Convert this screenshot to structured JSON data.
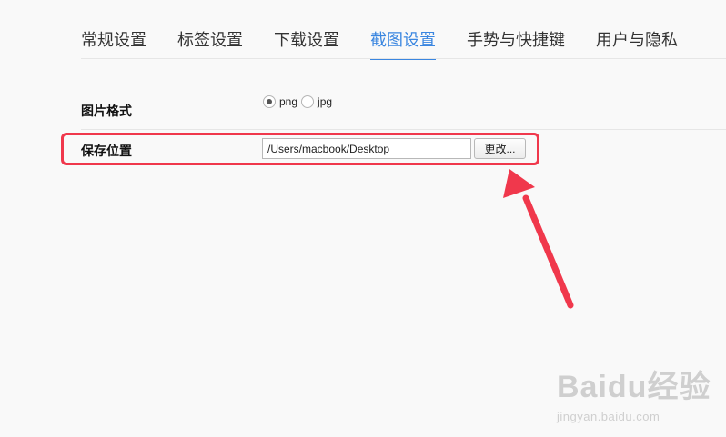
{
  "tabs": [
    {
      "label": "常规设置",
      "active": false
    },
    {
      "label": "标签设置",
      "active": false
    },
    {
      "label": "下载设置",
      "active": false
    },
    {
      "label": "截图设置",
      "active": true
    },
    {
      "label": "手势与快捷键",
      "active": false
    },
    {
      "label": "用户与隐私",
      "active": false
    }
  ],
  "image_format": {
    "label": "图片格式",
    "options": [
      {
        "label": "png",
        "checked": true
      },
      {
        "label": "jpg",
        "checked": false
      }
    ]
  },
  "save_location": {
    "label": "保存位置",
    "path_value": "/Users/macbook/Desktop",
    "change_button": "更改..."
  },
  "colors": {
    "accent": "#3a86e0",
    "annotation_red": "#f0384c"
  },
  "watermark": {
    "brand": "Baidu经验",
    "url": "jingyan.baidu.com"
  }
}
